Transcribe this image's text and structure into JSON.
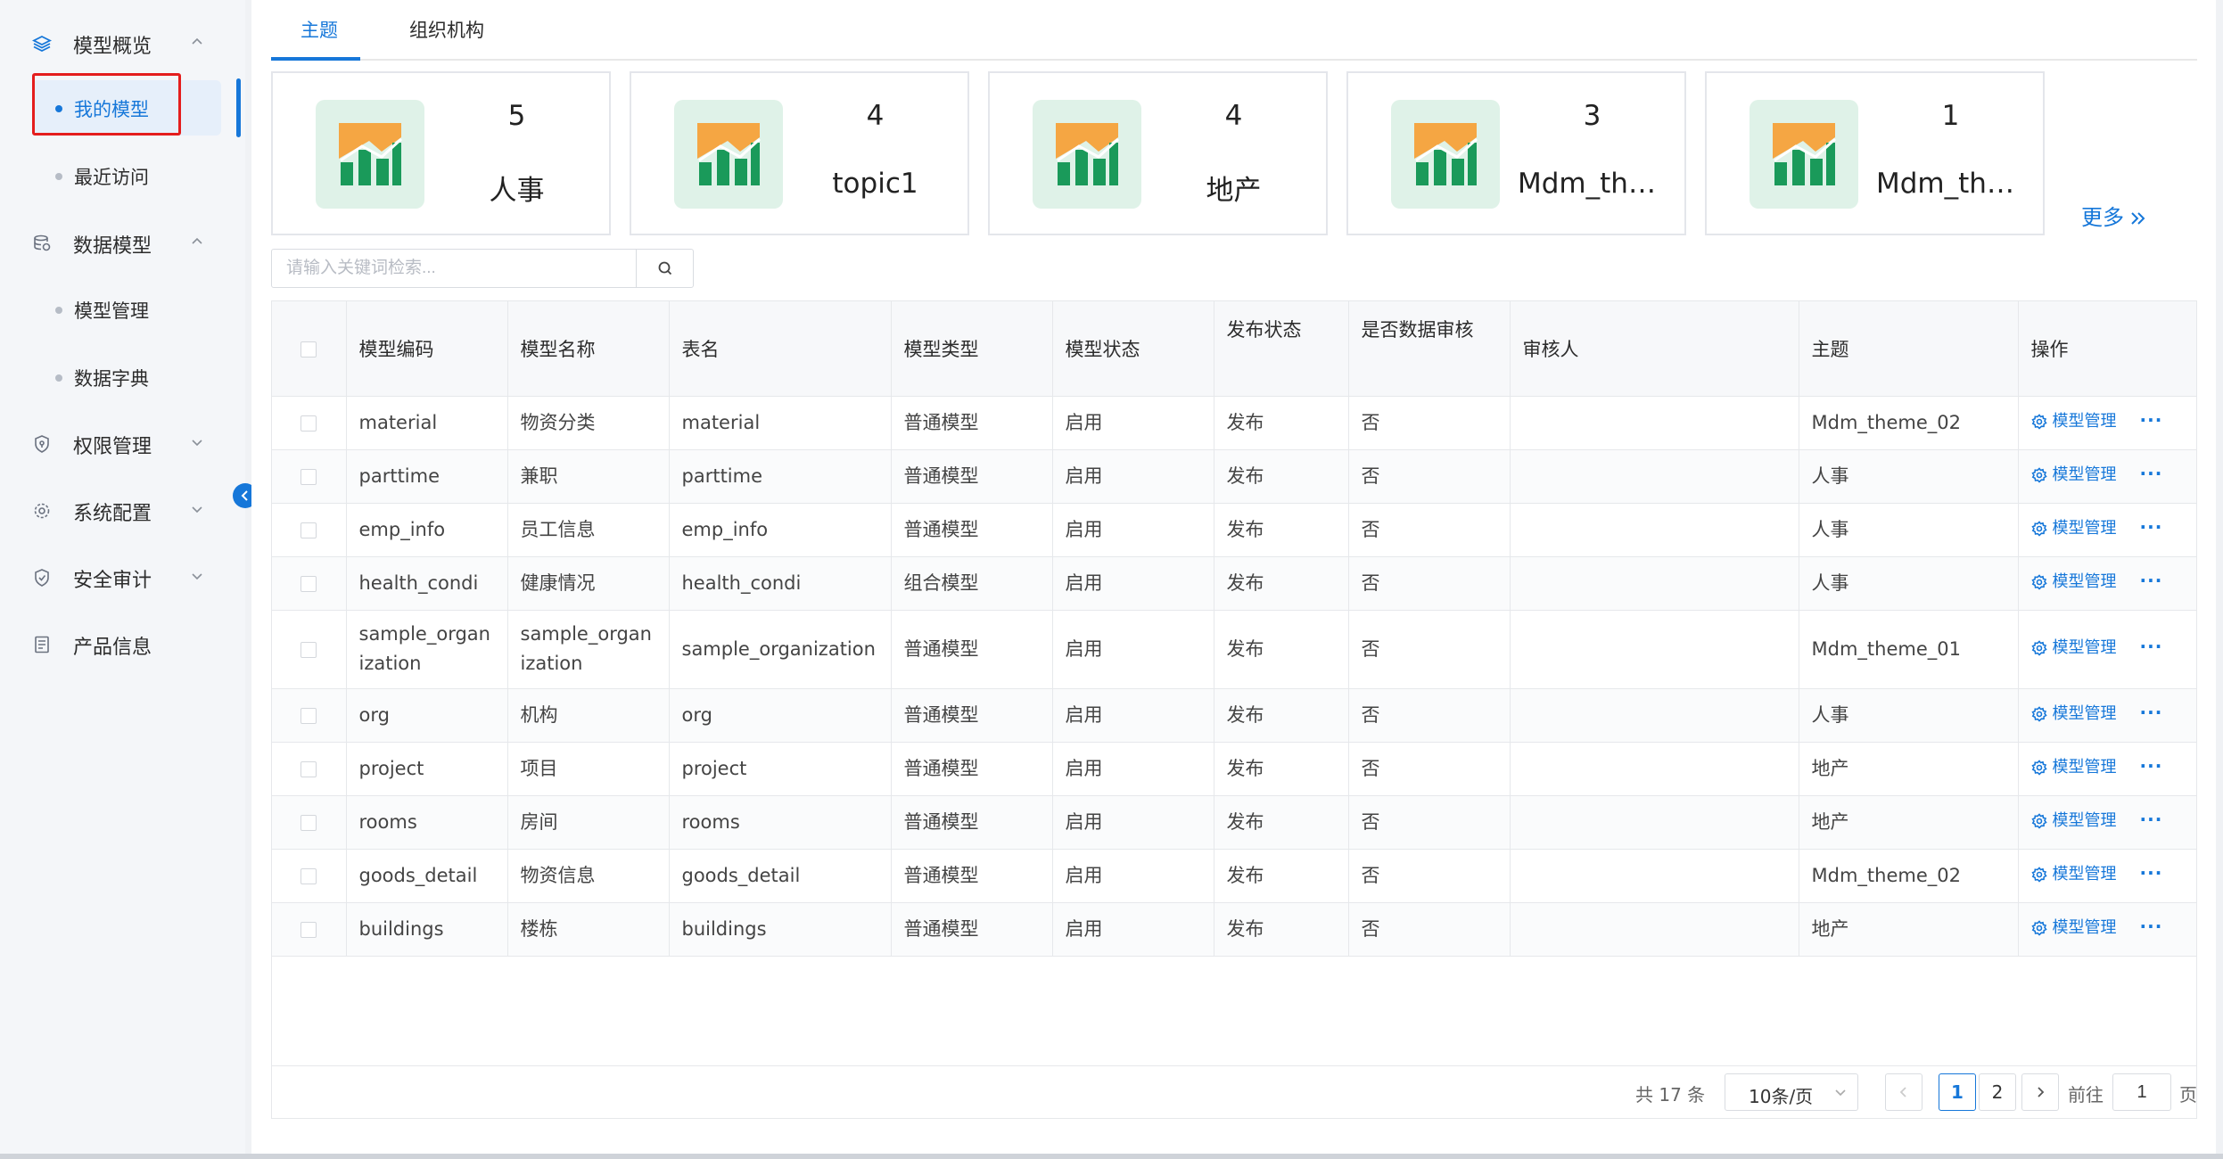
{
  "sidebar": {
    "groups": [
      {
        "label": "模型概览",
        "icon": "layers-icon"
      },
      {
        "label": "数据模型",
        "icon": "database-icon"
      },
      {
        "label": "权限管理",
        "icon": "shield-icon"
      },
      {
        "label": "系统配置",
        "icon": "settings-icon"
      },
      {
        "label": "安全审计",
        "icon": "security-icon"
      },
      {
        "label": "产品信息",
        "icon": "document-icon"
      }
    ],
    "subitems": {
      "my_models": "我的模型",
      "recent": "最近访问",
      "model_manage": "模型管理",
      "dictionary": "数据字典"
    }
  },
  "tabs": [
    "主题",
    "组织机构"
  ],
  "theme_cards": [
    {
      "count": "5",
      "name": "人事"
    },
    {
      "count": "4",
      "name": "topic1"
    },
    {
      "count": "4",
      "name": "地产"
    },
    {
      "count": "3",
      "name": "Mdm_them..."
    },
    {
      "count": "1",
      "name": "Mdm_them..."
    }
  ],
  "more_label": "更多",
  "search": {
    "placeholder": "请输入关键词检索..."
  },
  "table": {
    "headers": [
      "模型编码",
      "模型名称",
      "表名",
      "模型类型",
      "模型状态",
      "发布状态",
      "是否数据审核",
      "审核人",
      "主题",
      "操作"
    ],
    "rows": [
      {
        "code": "material",
        "name": "物资分类",
        "table": "material",
        "type": "普通模型",
        "status": "启用",
        "publish": "发布",
        "audit": "否",
        "auditor": "",
        "theme": "Mdm_theme_02"
      },
      {
        "code": "parttime",
        "name": "兼职",
        "table": "parttime",
        "type": "普通模型",
        "status": "启用",
        "publish": "发布",
        "audit": "否",
        "auditor": "",
        "theme": "人事"
      },
      {
        "code": "emp_info",
        "name": "员工信息",
        "table": "emp_info",
        "type": "普通模型",
        "status": "启用",
        "publish": "发布",
        "audit": "否",
        "auditor": "",
        "theme": "人事"
      },
      {
        "code": "health_condi",
        "name": "健康情况",
        "table": "health_condi",
        "type": "组合模型",
        "status": "启用",
        "publish": "发布",
        "audit": "否",
        "auditor": "",
        "theme": "人事"
      },
      {
        "code": "sample_organization",
        "name": "sample_organization",
        "table": "sample_organization",
        "type": "普通模型",
        "status": "启用",
        "publish": "发布",
        "audit": "否",
        "auditor": "",
        "theme": "Mdm_theme_01"
      },
      {
        "code": "org",
        "name": "机构",
        "table": "org",
        "type": "普通模型",
        "status": "启用",
        "publish": "发布",
        "audit": "否",
        "auditor": "",
        "theme": "人事"
      },
      {
        "code": "project",
        "name": "项目",
        "table": "project",
        "type": "普通模型",
        "status": "启用",
        "publish": "发布",
        "audit": "否",
        "auditor": "",
        "theme": "地产"
      },
      {
        "code": "rooms",
        "name": "房间",
        "table": "rooms",
        "type": "普通模型",
        "status": "启用",
        "publish": "发布",
        "audit": "否",
        "auditor": "",
        "theme": "地产"
      },
      {
        "code": "goods_detail",
        "name": "物资信息",
        "table": "goods_detail",
        "type": "普通模型",
        "status": "启用",
        "publish": "发布",
        "audit": "否",
        "auditor": "",
        "theme": "Mdm_theme_02"
      },
      {
        "code": "buildings",
        "name": "楼栋",
        "table": "buildings",
        "type": "普通模型",
        "status": "启用",
        "publish": "发布",
        "audit": "否",
        "auditor": "",
        "theme": "地产"
      }
    ],
    "op_label": "模型管理",
    "more_icon": "···"
  },
  "pagination": {
    "total": "共 17 条",
    "page_size": "10条/页",
    "pages": [
      "1",
      "2"
    ],
    "current": "1",
    "goto_label": "前往",
    "goto_value": "1",
    "goto_suffix": "页"
  },
  "colors": {
    "accent": "#1677d9",
    "highlight_box": "#e41d1d",
    "icon_bg": "#dff2e8",
    "chart_green": "#1a9a5a",
    "chart_orange": "#f5a643"
  }
}
